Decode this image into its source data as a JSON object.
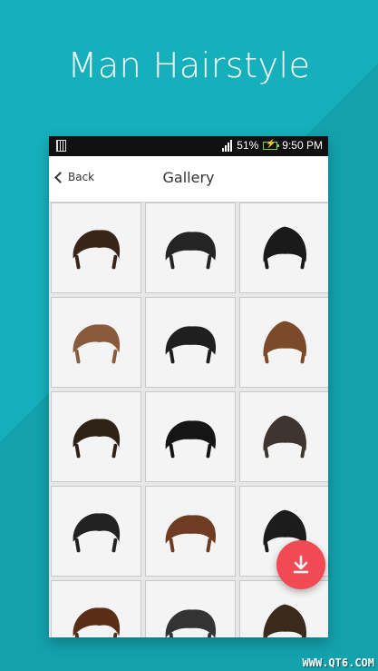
{
  "headline": "Man Hairstyle",
  "status_bar": {
    "battery_percent": "51%",
    "time": "9:50 PM",
    "icons": [
      "sim-icon",
      "signal-icon",
      "battery-charging-icon"
    ]
  },
  "app_bar": {
    "back_label": "Back",
    "title": "Gallery"
  },
  "gallery": {
    "item_count": 15,
    "colors": [
      "#3a2318",
      "#242424",
      "#1a1a1a",
      "#8a5a3c",
      "#1f1f1f",
      "#7b4a28",
      "#2e2116",
      "#151515",
      "#3e3430",
      "#222222",
      "#6e3c22",
      "#1c1c1c",
      "#5a2e16",
      "#333333",
      "#3b2a1c"
    ]
  },
  "fab": {
    "icon": "download-icon",
    "color": "#f24a55"
  },
  "watermark": "WWW.QT6.COM"
}
